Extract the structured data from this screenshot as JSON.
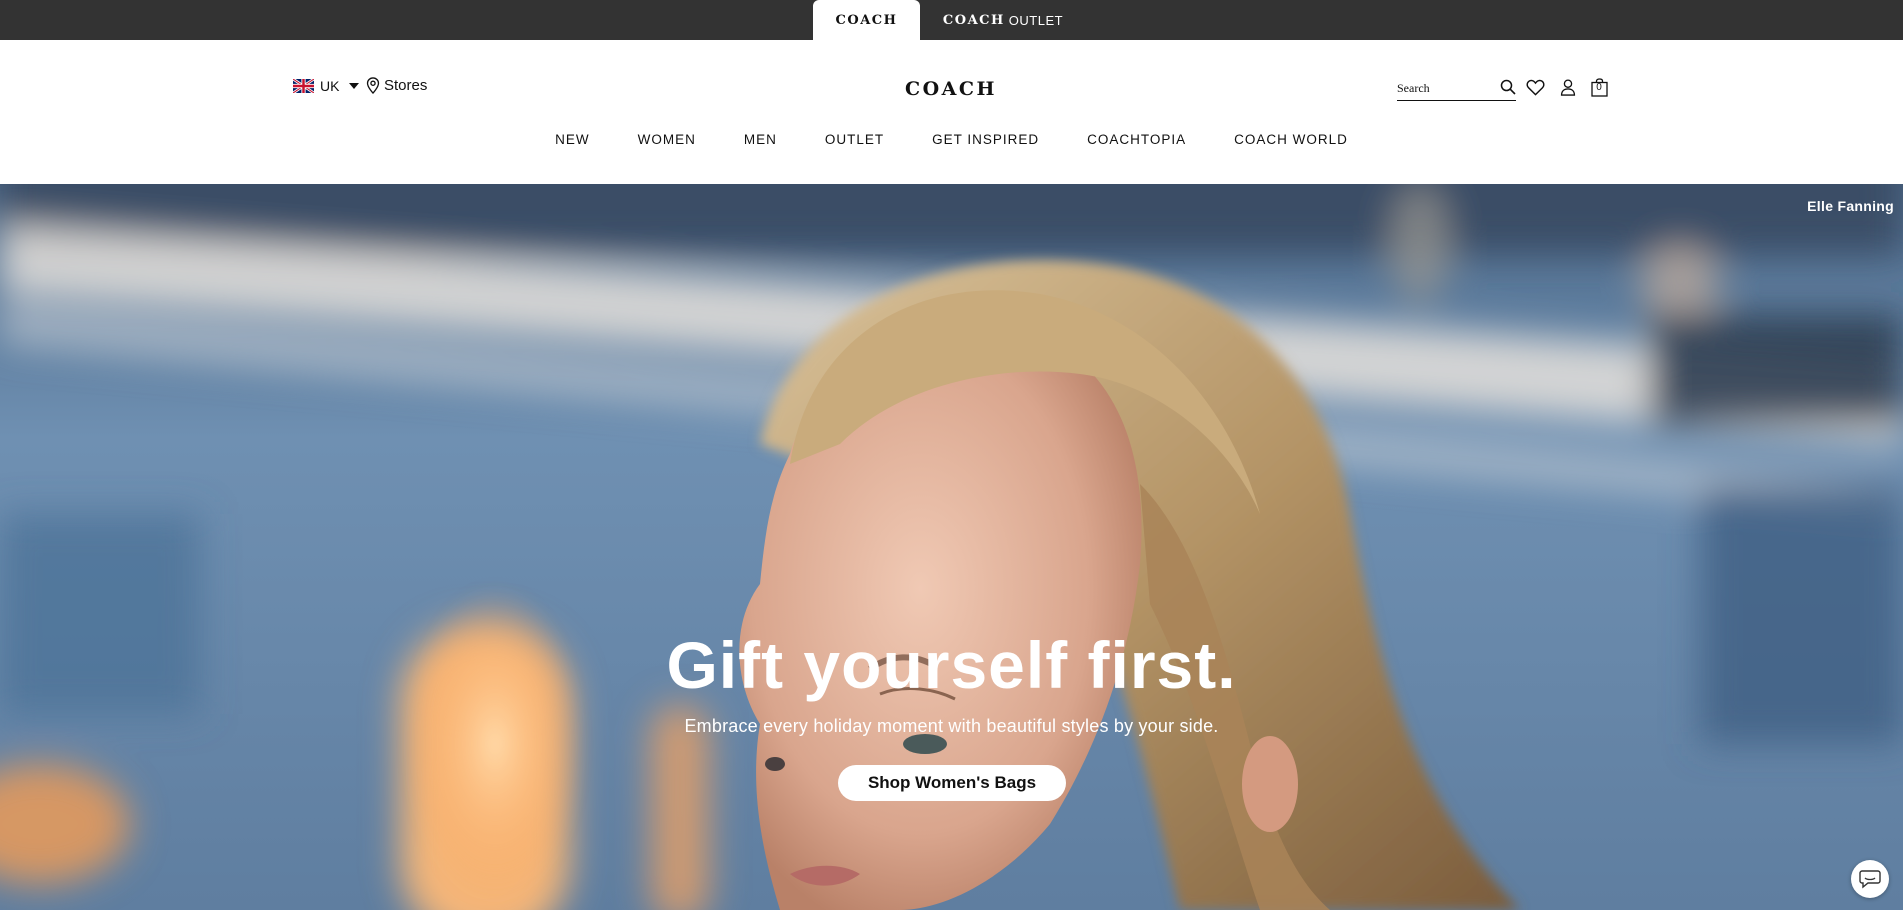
{
  "brand_bar": {
    "coach_tab": "COACH",
    "outlet_tab_brand": "COACH",
    "outlet_tab_word": "OUTLET"
  },
  "header": {
    "locale": "UK",
    "stores": "Stores",
    "logo": "COACH",
    "search_placeholder": "Search",
    "bag_count": "0"
  },
  "nav": {
    "items": [
      "NEW",
      "WOMEN",
      "MEN",
      "OUTLET",
      "GET INSPIRED",
      "COACHTOPIA",
      "COACH WORLD"
    ]
  },
  "hero": {
    "credit": "Elle Fanning",
    "headline": "Gift yourself first.",
    "subline": "Embrace every holiday moment with beautiful styles by your side.",
    "cta": "Shop Women's Bags"
  },
  "colors": {
    "brand_bar": "#333333",
    "text": "#111111",
    "hero_text": "#ffffff"
  }
}
